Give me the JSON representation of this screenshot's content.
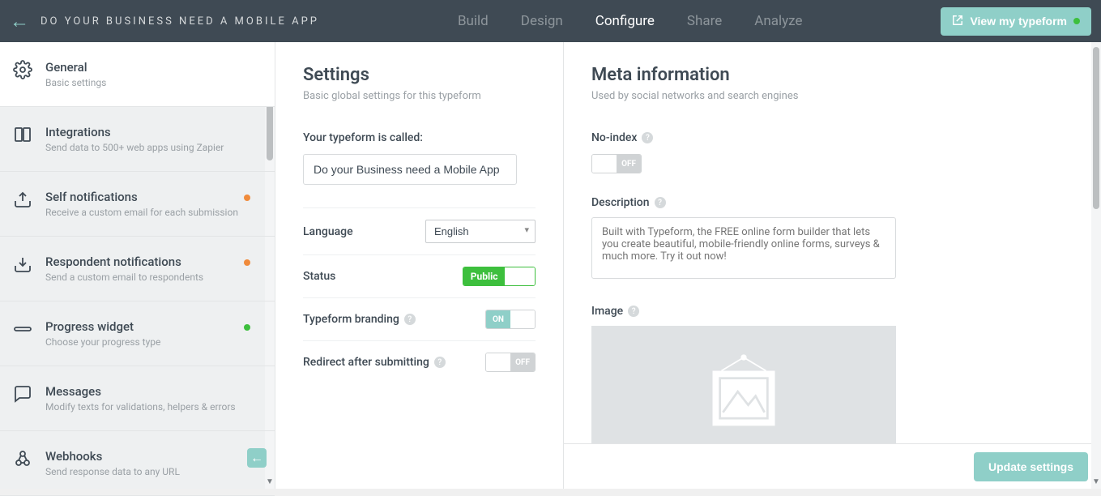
{
  "header": {
    "title": "DO YOUR BUSINESS NEED A MOBILE APP",
    "nav": [
      {
        "label": "Build",
        "active": false
      },
      {
        "label": "Design",
        "active": false
      },
      {
        "label": "Configure",
        "active": true
      },
      {
        "label": "Share",
        "active": false
      },
      {
        "label": "Analyze",
        "active": false
      }
    ],
    "view_button": "View my typeform"
  },
  "sidebar": {
    "items": [
      {
        "title": "General",
        "sub": "Basic settings",
        "icon": "gear",
        "active": true,
        "badge": null
      },
      {
        "title": "Integrations",
        "sub": "Send data to 500+ web apps using Zapier",
        "icon": "blocks",
        "active": false,
        "badge": null
      },
      {
        "title": "Self notifications",
        "sub": "Receive a custom email for each submission",
        "icon": "upload-tray",
        "active": false,
        "badge": "orange"
      },
      {
        "title": "Respondent notifications",
        "sub": "Send a custom email to respondents",
        "icon": "download-tray",
        "active": false,
        "badge": "orange"
      },
      {
        "title": "Progress widget",
        "sub": "Choose your progress type",
        "icon": "clip",
        "active": false,
        "badge": "green"
      },
      {
        "title": "Messages",
        "sub": "Modify texts for validations, helpers & errors",
        "icon": "chat",
        "active": false,
        "badge": null
      },
      {
        "title": "Webhooks",
        "sub": "Send response data to any URL",
        "icon": "webhook",
        "active": false,
        "badge": null
      }
    ]
  },
  "settings": {
    "title": "Settings",
    "sub": "Basic global settings for this typeform",
    "name_label": "Your typeform is called:",
    "name_value": "Do your Business need a Mobile App",
    "language_label": "Language",
    "language_value": "English",
    "status_label": "Status",
    "status_value": "Public",
    "branding_label": "Typeform branding",
    "branding_state": "ON",
    "redirect_label": "Redirect after submitting",
    "redirect_state": "OFF"
  },
  "meta": {
    "title": "Meta information",
    "sub": "Used by social networks and search engines",
    "noindex_label": "No-index",
    "noindex_state": "OFF",
    "description_label": "Description",
    "description_placeholder": "Built with Typeform, the FREE online form builder that lets you create beautiful, mobile-friendly online forms, surveys & much more. Try it out now!",
    "image_label": "Image"
  },
  "footer": {
    "update_button": "Update settings"
  }
}
